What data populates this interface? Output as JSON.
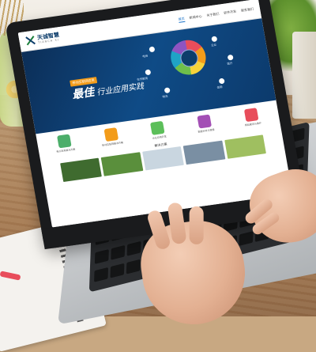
{
  "site": {
    "logo_text": "天诚智慧",
    "logo_sub": "TIANCH XI",
    "nav": [
      "首页",
      "新闻中心",
      "关于我们",
      "软件开发",
      "联系我们"
    ],
    "banner": {
      "tag": "移动互联网应用",
      "title_big": "最佳",
      "title_rest": "行业应用实践"
    },
    "orbit_labels": [
      "电商",
      "企业",
      "在线教育",
      "医疗",
      "物流",
      "金融"
    ],
    "features": [
      {
        "text": "电子政务解决方案",
        "color": "#4cae6a"
      },
      {
        "text": "移动互联网解决方案",
        "color": "#f39c1a"
      },
      {
        "text": "企业应用开发",
        "color": "#5cbf5a"
      },
      {
        "text": "数据分析与管理",
        "color": "#a34fb5"
      },
      {
        "text": "网站建设与维护",
        "color": "#e84d5b"
      }
    ],
    "section_title": "解决方案",
    "thumb_colors": [
      "#3f6b2f",
      "#5a8f3c",
      "#c9d6e0",
      "#7a8fa3",
      "#9fbf60"
    ]
  }
}
